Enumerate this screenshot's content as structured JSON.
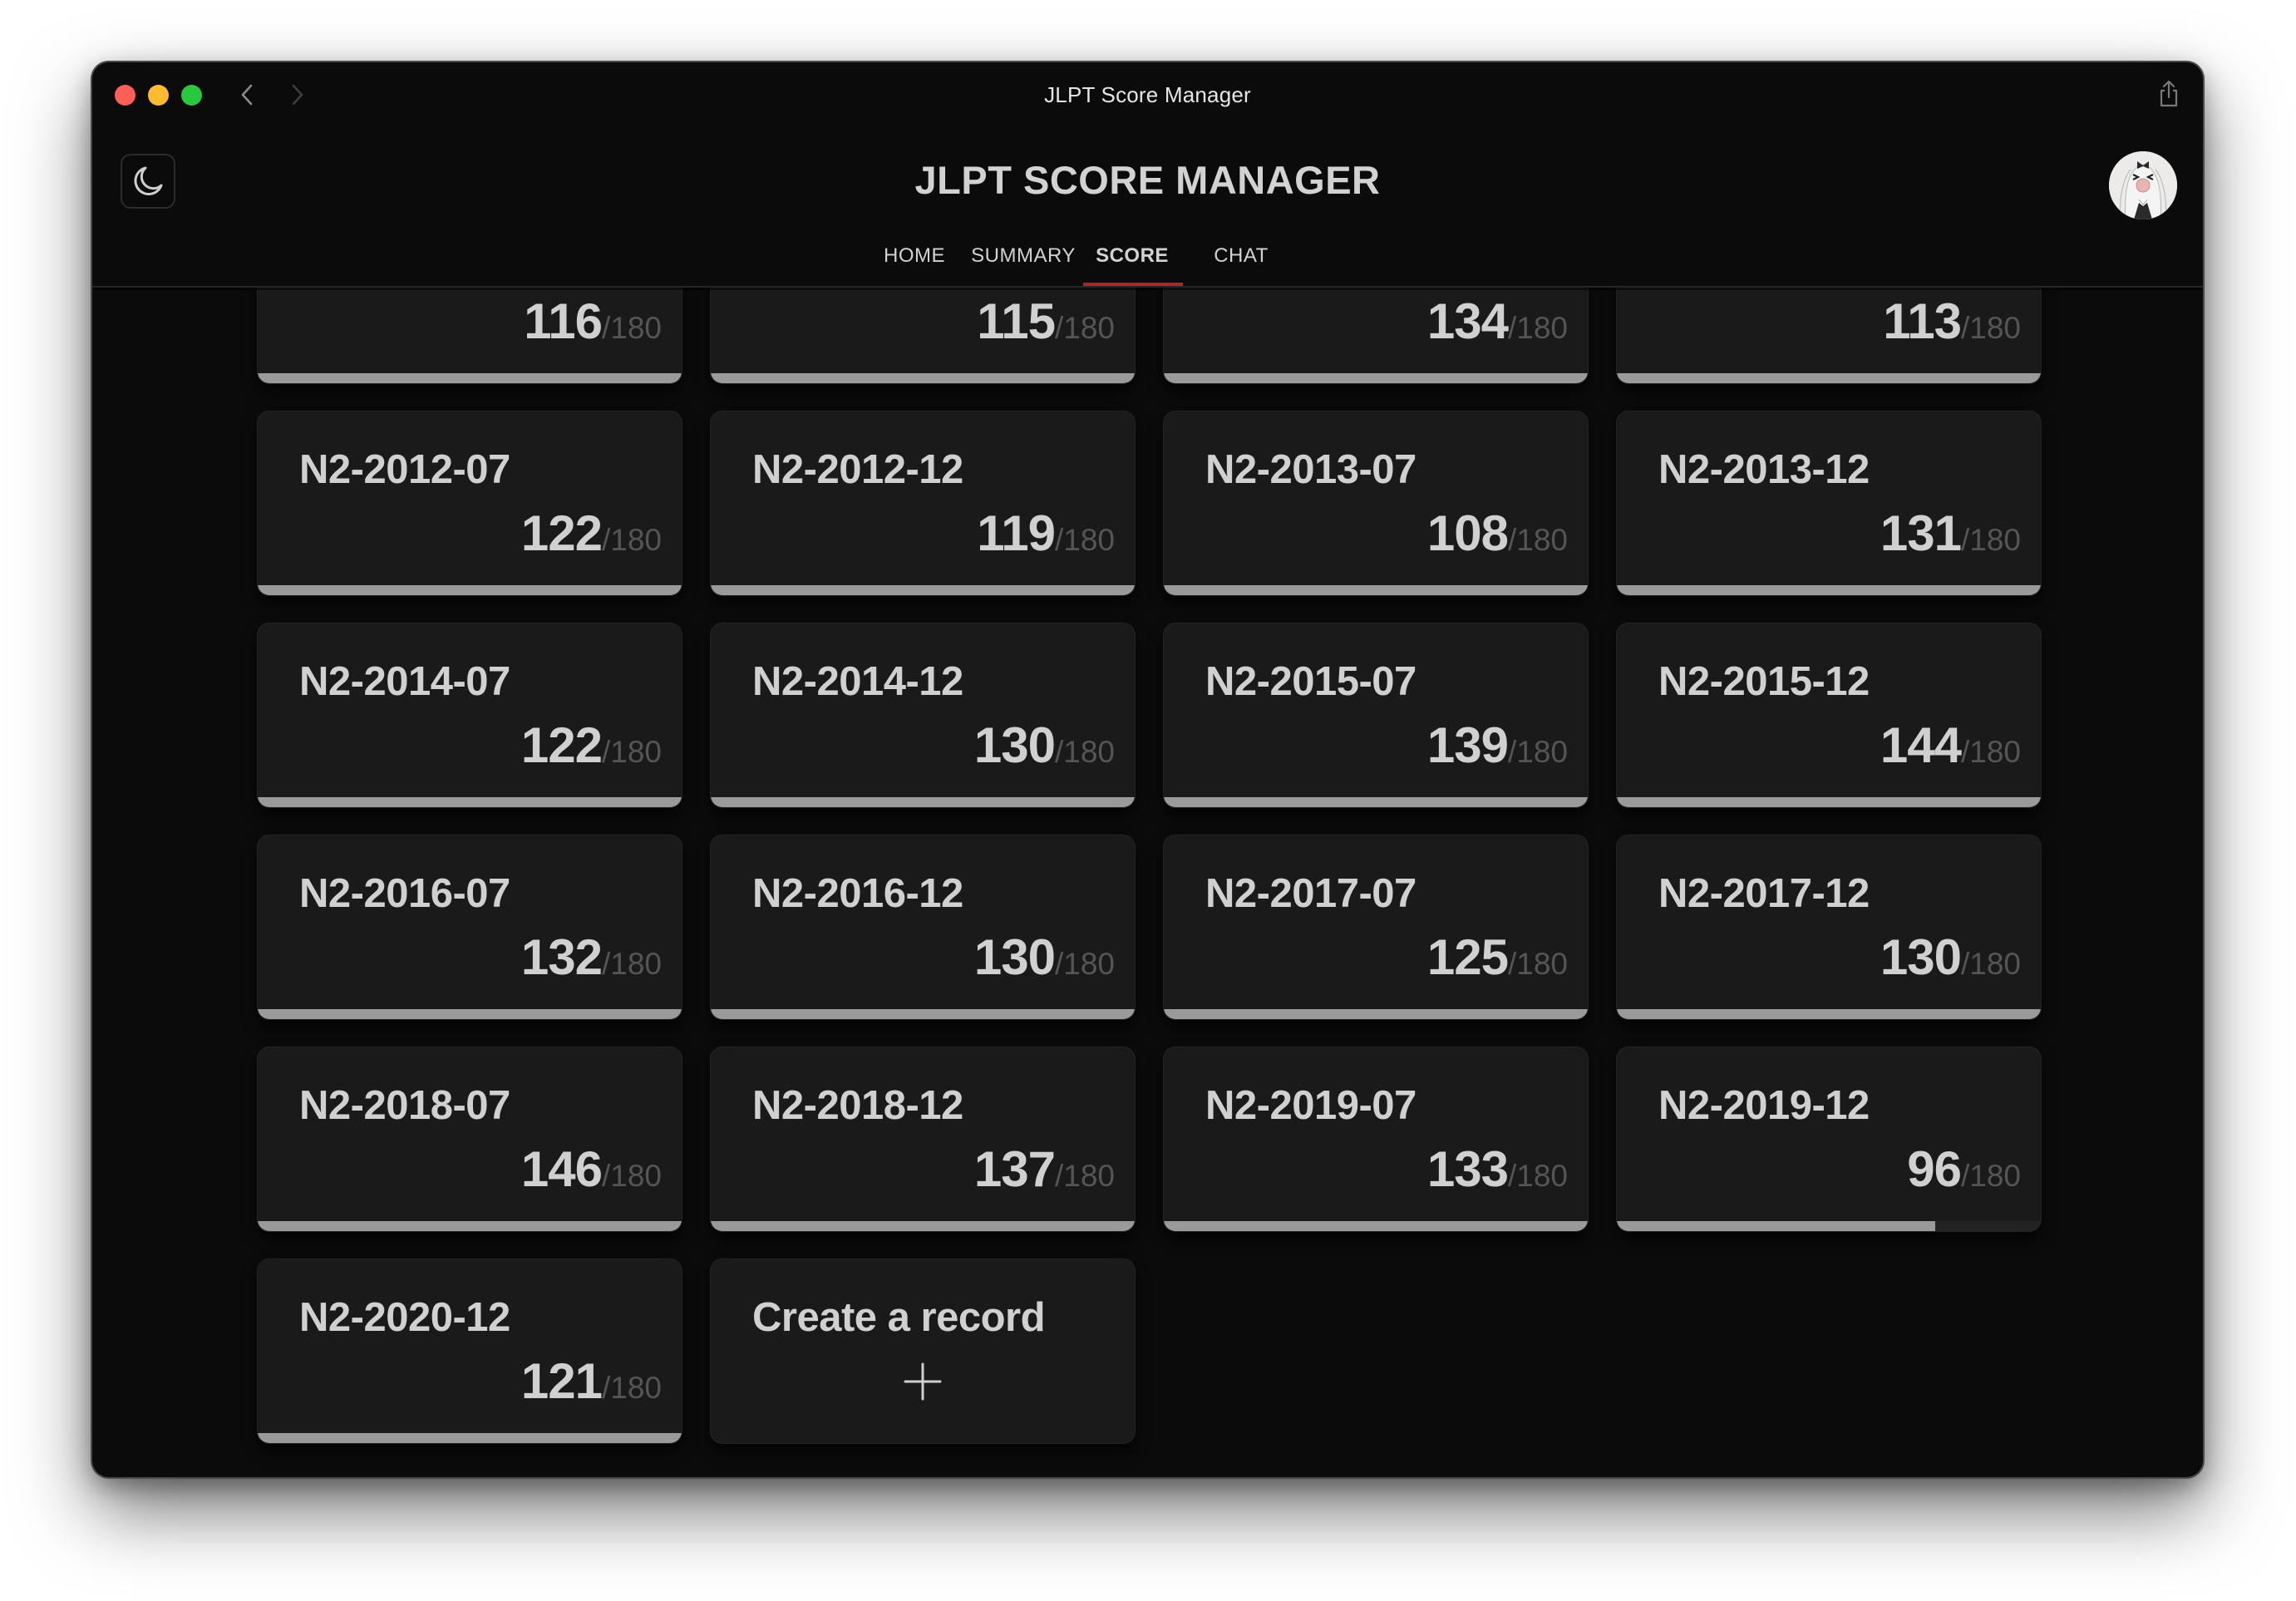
{
  "window": {
    "title": "JLPT Score Manager",
    "controls": [
      "close",
      "minimize",
      "maximize"
    ],
    "nav": {
      "back_icon": "chevron-left-icon",
      "forward_icon": "chevron-right-icon",
      "forward_enabled": false
    },
    "share_icon": "share-icon"
  },
  "header": {
    "theme_toggle_icon": "moon-icon",
    "app_title": "JLPT SCORE MANAGER",
    "avatar_icon": "user-avatar",
    "tabs": [
      {
        "label": "HOME",
        "active": false
      },
      {
        "label": "SUMMARY",
        "active": false
      },
      {
        "label": "SCORE",
        "active": true
      },
      {
        "label": "CHAT",
        "active": false
      }
    ],
    "accent_color": "#b0242f"
  },
  "records": [
    {
      "title": "",
      "score": "116",
      "max": "/180",
      "progress": 1.0
    },
    {
      "title": "",
      "score": "115",
      "max": "/180",
      "progress": 1.0
    },
    {
      "title": "",
      "score": "134",
      "max": "/180",
      "progress": 1.0
    },
    {
      "title": "",
      "score": "113",
      "max": "/180",
      "progress": 1.0
    },
    {
      "title": "N2-2012-07",
      "score": "122",
      "max": "/180",
      "progress": 1.0
    },
    {
      "title": "N2-2012-12",
      "score": "119",
      "max": "/180",
      "progress": 1.0
    },
    {
      "title": "N2-2013-07",
      "score": "108",
      "max": "/180",
      "progress": 1.0
    },
    {
      "title": "N2-2013-12",
      "score": "131",
      "max": "/180",
      "progress": 1.0
    },
    {
      "title": "N2-2014-07",
      "score": "122",
      "max": "/180",
      "progress": 1.0
    },
    {
      "title": "N2-2014-12",
      "score": "130",
      "max": "/180",
      "progress": 1.0
    },
    {
      "title": "N2-2015-07",
      "score": "139",
      "max": "/180",
      "progress": 1.0
    },
    {
      "title": "N2-2015-12",
      "score": "144",
      "max": "/180",
      "progress": 1.0
    },
    {
      "title": "N2-2016-07",
      "score": "132",
      "max": "/180",
      "progress": 1.0
    },
    {
      "title": "N2-2016-12",
      "score": "130",
      "max": "/180",
      "progress": 1.0
    },
    {
      "title": "N2-2017-07",
      "score": "125",
      "max": "/180",
      "progress": 1.0
    },
    {
      "title": "N2-2017-12",
      "score": "130",
      "max": "/180",
      "progress": 1.0
    },
    {
      "title": "N2-2018-07",
      "score": "146",
      "max": "/180",
      "progress": 1.0
    },
    {
      "title": "N2-2018-12",
      "score": "137",
      "max": "/180",
      "progress": 1.0
    },
    {
      "title": "N2-2019-07",
      "score": "133",
      "max": "/180",
      "progress": 1.0
    },
    {
      "title": "N2-2019-12",
      "score": "96",
      "max": "/180",
      "progress": 0.75
    },
    {
      "title": "N2-2020-12",
      "score": "121",
      "max": "/180",
      "progress": 1.0
    }
  ],
  "create_card": {
    "label": "Create a record",
    "icon": "plus-icon"
  },
  "colors": {
    "window_bg": "#0b0b0b",
    "card_bg": "#1a1a1a",
    "text": "#d0d0d0",
    "muted_text": "#555555",
    "bar_fill": "#9a9a9a",
    "traffic_close": "#ff5f57",
    "traffic_minimize": "#febc2e",
    "traffic_maximize": "#28c840"
  }
}
